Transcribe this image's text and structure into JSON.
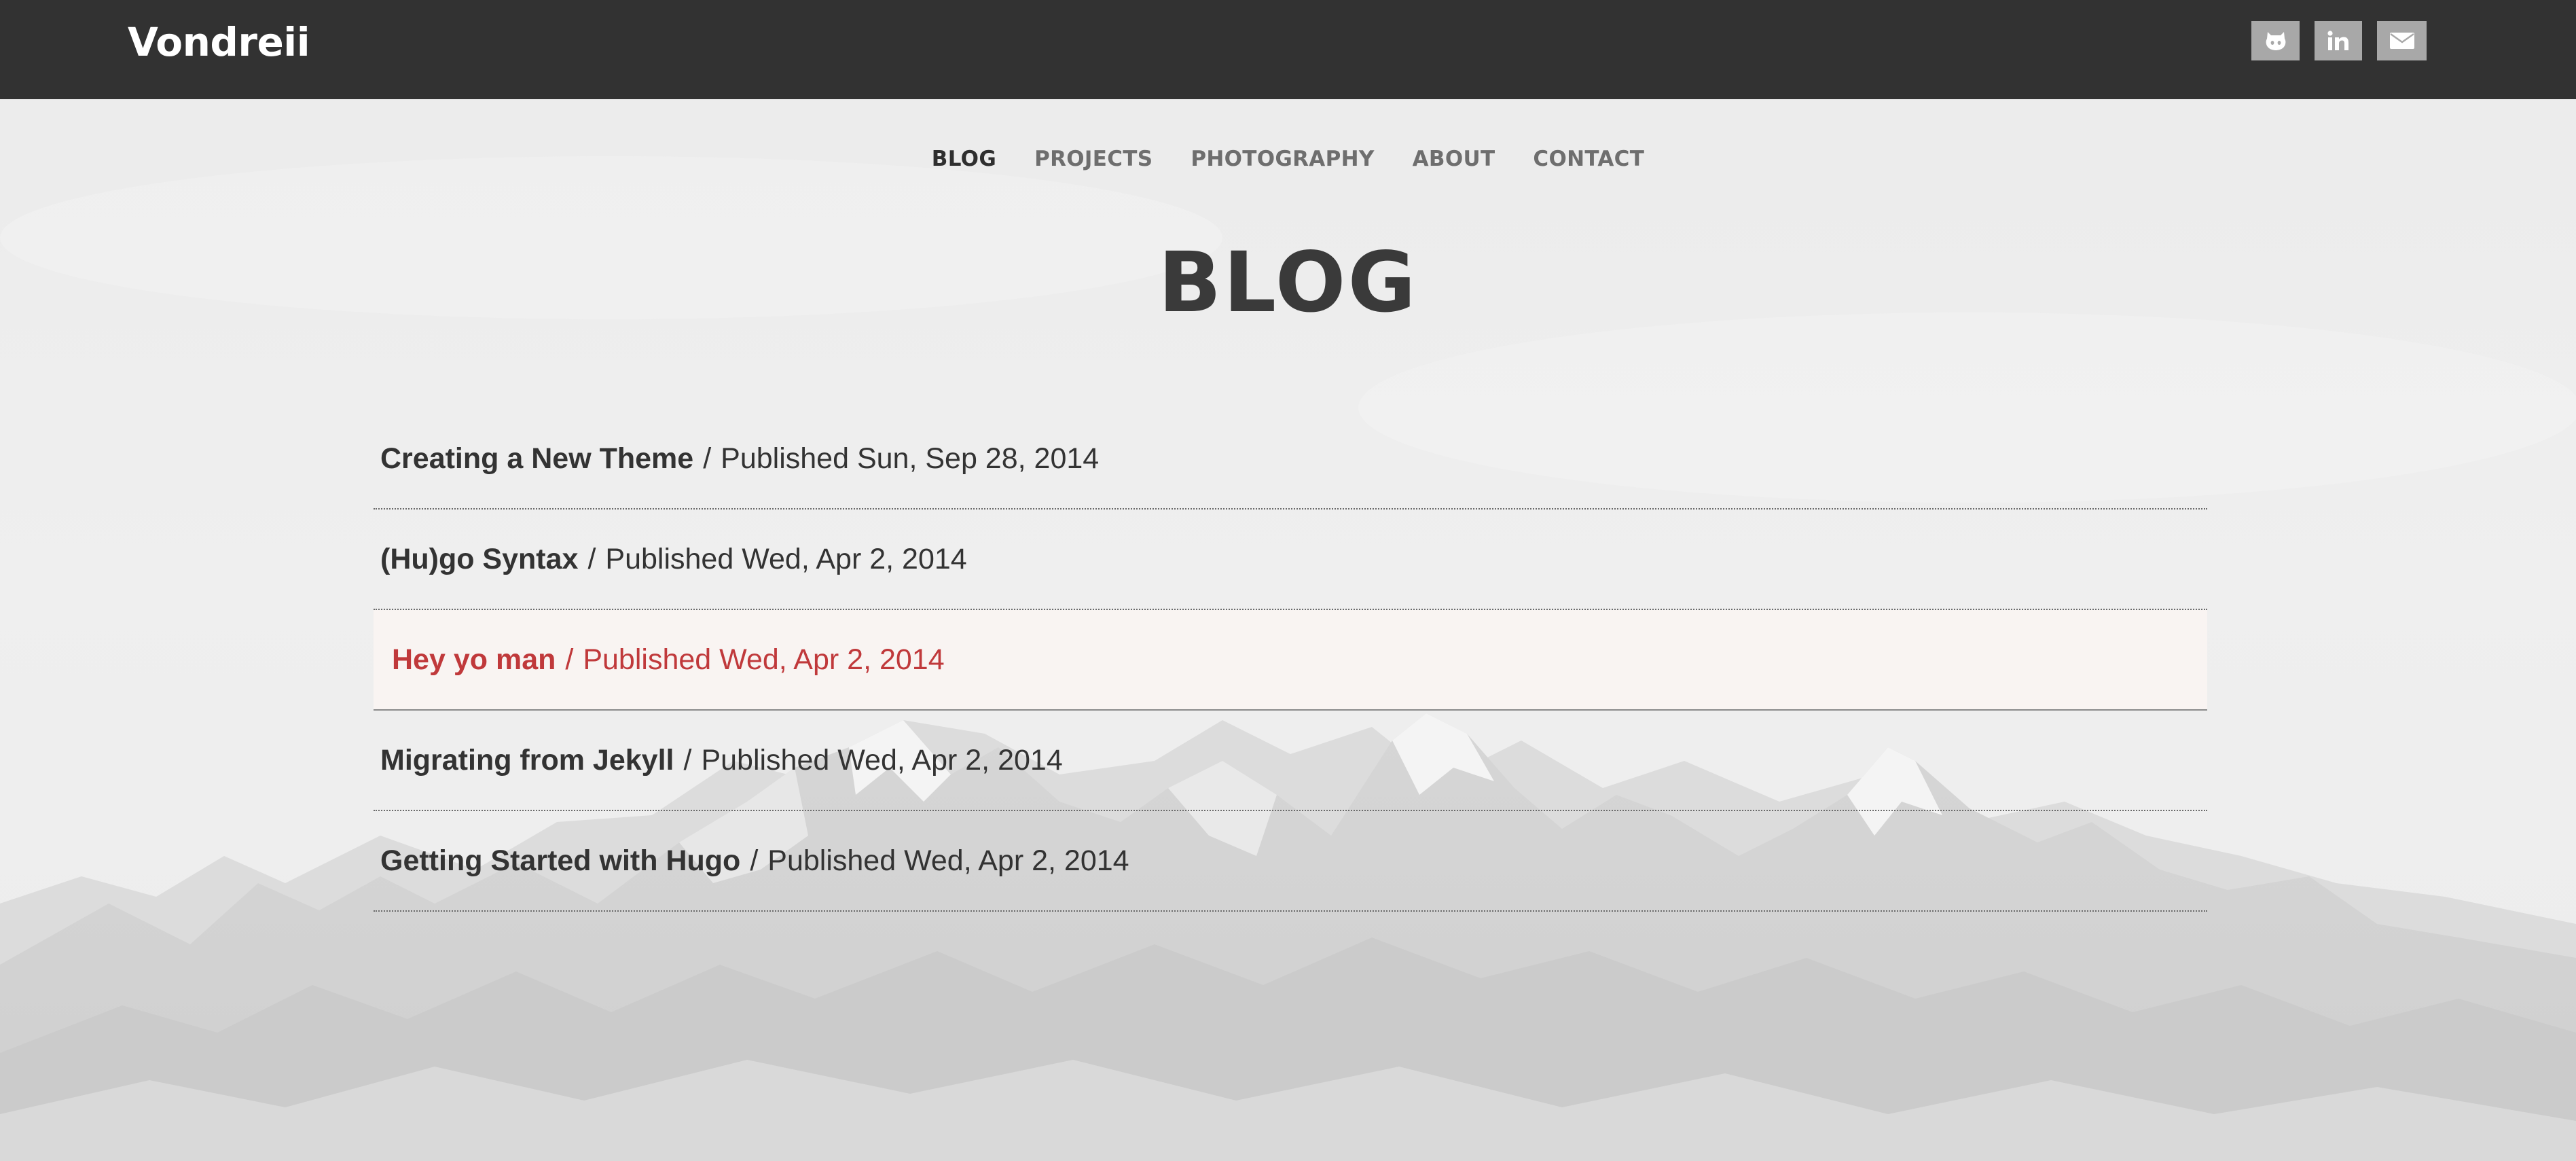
{
  "header": {
    "brand": "Vondreii",
    "social": [
      {
        "name": "github",
        "icon": "github-icon"
      },
      {
        "name": "linkedin",
        "icon": "linkedin-icon"
      },
      {
        "name": "email",
        "icon": "envelope-icon"
      }
    ]
  },
  "nav": {
    "items": [
      {
        "label": "BLOG",
        "active": true
      },
      {
        "label": "PROJECTS",
        "active": false
      },
      {
        "label": "PHOTOGRAPHY",
        "active": false
      },
      {
        "label": "ABOUT",
        "active": false
      },
      {
        "label": "CONTACT",
        "active": false
      }
    ]
  },
  "main": {
    "title": "BLOG",
    "separator": "/",
    "posts": [
      {
        "title": "Creating a New Theme",
        "published": "Published Sun, Sep 28, 2014"
      },
      {
        "title": "(Hu)go Syntax",
        "published": "Published Wed, Apr 2, 2014"
      },
      {
        "title": "Hey yo man",
        "published": "Published Wed, Apr 2, 2014",
        "hovered": true
      },
      {
        "title": "Migrating from Jekyll",
        "published": "Published Wed, Apr 2, 2014"
      },
      {
        "title": "Getting Started with Hugo",
        "published": "Published Wed, Apr 2, 2014"
      }
    ]
  },
  "colors": {
    "header_bg": "#323232",
    "accent_hover": "#c0393b",
    "text": "#333333",
    "icon_bg": "#a8a8a8"
  }
}
